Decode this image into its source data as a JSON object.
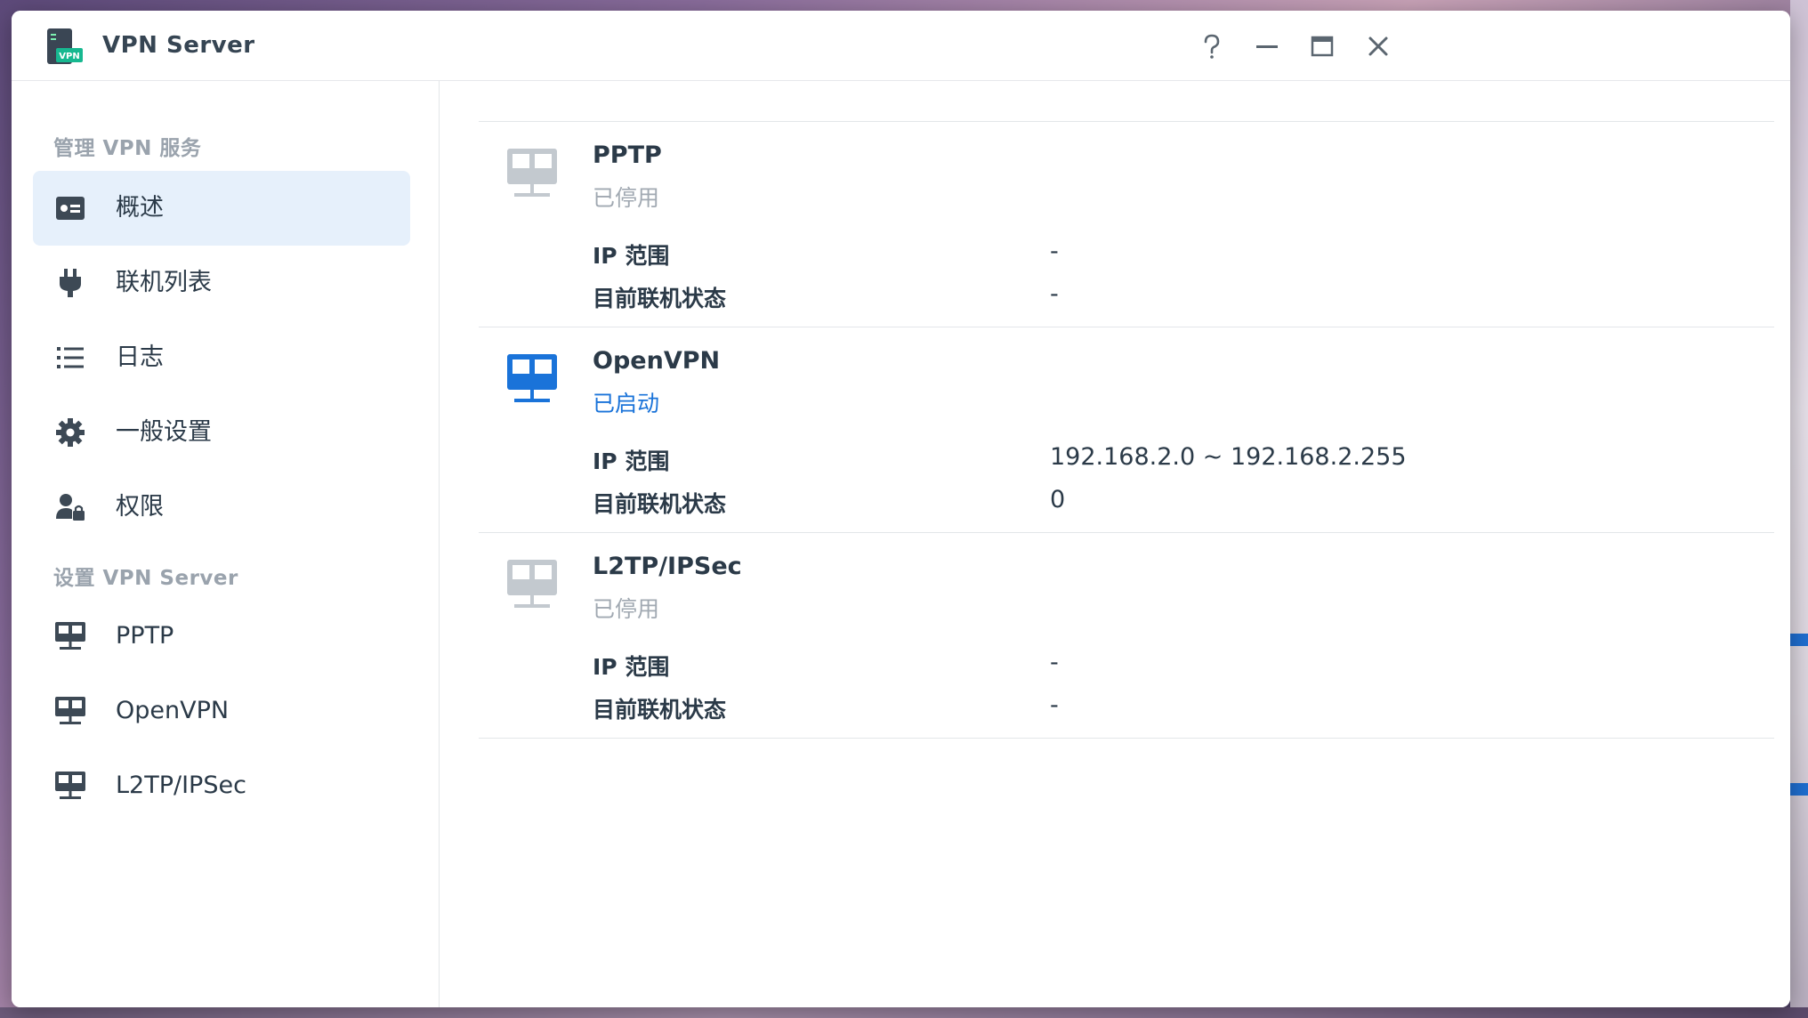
{
  "window": {
    "title": "VPN Server",
    "app_badge": "VPN"
  },
  "sidebar": {
    "section1_title": "管理 VPN 服务",
    "section2_title": "设置 VPN Server",
    "items": [
      {
        "label": "概述",
        "icon": "overview-card-icon"
      },
      {
        "label": "联机列表",
        "icon": "plug-icon"
      },
      {
        "label": "日志",
        "icon": "list-icon"
      },
      {
        "label": "一般设置",
        "icon": "gear-icon"
      },
      {
        "label": "权限",
        "icon": "user-lock-icon"
      },
      {
        "label": "PPTP",
        "icon": "network-icon"
      },
      {
        "label": "OpenVPN",
        "icon": "network-icon"
      },
      {
        "label": "L2TP/IPSec",
        "icon": "network-icon"
      }
    ]
  },
  "services": [
    {
      "name": "PPTP",
      "status": "已停用",
      "ip_label": "IP 范围",
      "ip_value": "-",
      "conn_label": "目前联机状态",
      "conn_value": "-"
    },
    {
      "name": "OpenVPN",
      "status": "已启动",
      "ip_label": "IP 范围",
      "ip_value": "192.168.2.0 ~ 192.168.2.255",
      "conn_label": "目前联机状态",
      "conn_value": "0"
    },
    {
      "name": "L2TP/IPSec",
      "status": "已停用",
      "ip_label": "IP 范围",
      "ip_value": "-",
      "conn_label": "目前联机状态",
      "conn_value": "-"
    }
  ],
  "colors": {
    "accent": "#1a73d9",
    "active_bg": "#e6f0fb",
    "disabled": "#a1a9b2",
    "text": "#2b3a48"
  }
}
